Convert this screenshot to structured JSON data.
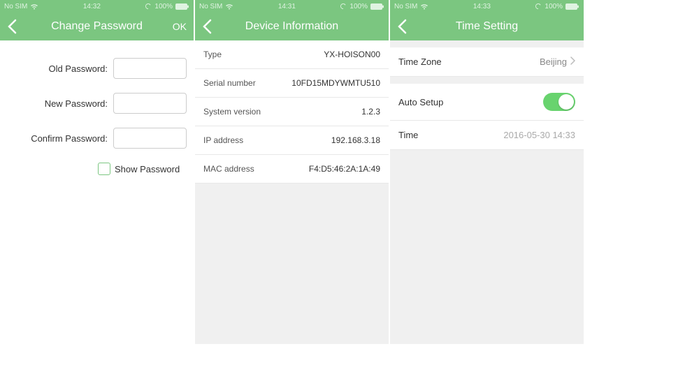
{
  "screen1": {
    "status": {
      "carrier": "No SIM",
      "time": "14:32",
      "battery": "100%"
    },
    "nav": {
      "title": "Change Password",
      "ok": "OK"
    },
    "form": {
      "old_label": "Old Password:",
      "new_label": "New Password:",
      "confirm_label": "Confirm Password:",
      "show_label": "Show Password"
    }
  },
  "screen2": {
    "status": {
      "carrier": "No SIM",
      "time": "14:31",
      "battery": "100%"
    },
    "nav": {
      "title": "Device Information"
    },
    "rows": [
      {
        "label": "Type",
        "value": "YX-HOISON00"
      },
      {
        "label": "Serial number",
        "value": "10FD15MDYWMTU510"
      },
      {
        "label": "System version",
        "value": "1.2.3"
      },
      {
        "label": "IP address",
        "value": "192.168.3.18"
      },
      {
        "label": "MAC address",
        "value": "F4:D5:46:2A:1A:49"
      }
    ]
  },
  "screen3": {
    "status": {
      "carrier": "No SIM",
      "time": "14:33",
      "battery": "100%"
    },
    "nav": {
      "title": "Time Setting"
    },
    "timezone": {
      "label": "Time Zone",
      "value": "Beijing"
    },
    "autosetup": {
      "label": "Auto Setup"
    },
    "time": {
      "label": "Time",
      "value": "2016-05-30 14:33"
    }
  }
}
